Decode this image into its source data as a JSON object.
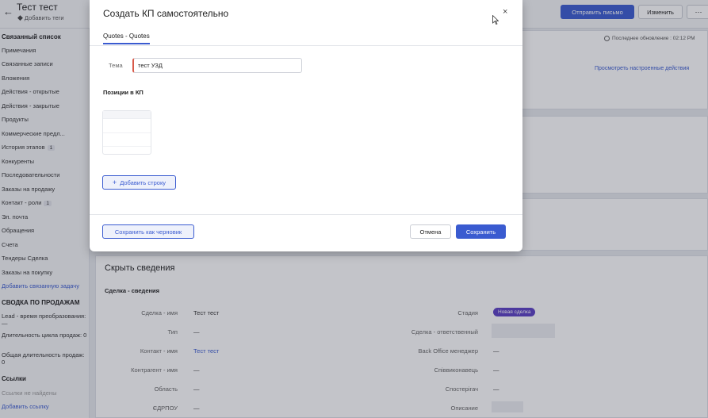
{
  "header": {
    "record_title": "Тест тест",
    "add_tags": "Добавить теги",
    "send_email": "Отправить письмо",
    "edit": "Изменить",
    "more": "⋯",
    "last_update": "Последнее обновление : 02:12 PM",
    "view_actions": "Просмотреть настроенные действия"
  },
  "sidebar": {
    "related_list_title": "Связанный список",
    "items": [
      {
        "label": "Примечания"
      },
      {
        "label": "Связанные записи"
      },
      {
        "label": "Вложения"
      },
      {
        "label": "Действия - открытые"
      },
      {
        "label": "Действия - закрытые"
      },
      {
        "label": "Продукты"
      },
      {
        "label": "Коммерческие предл..."
      },
      {
        "label": "История этапов",
        "count": "1"
      },
      {
        "label": "Конкуренты"
      },
      {
        "label": "Последовательности"
      },
      {
        "label": "Заказы на продажу"
      },
      {
        "label": "Контакт - роли",
        "count": "1"
      },
      {
        "label": "Эл. почта"
      },
      {
        "label": "Обращения"
      },
      {
        "label": "Счета"
      },
      {
        "label": "Тендеры Сделка"
      },
      {
        "label": "Заказы на покупку"
      }
    ],
    "add_related": "Добавить связанную задачу",
    "sales_summary_title": "СВОДКА ПО ПРОДАЖАМ",
    "summary": [
      {
        "label": "Lead - время преобразования: —"
      },
      {
        "label": "Длительность цикла продаж: 0"
      },
      {
        "label": "Общая длительность продаж: 0"
      }
    ],
    "links_title": "Ссылки",
    "links_empty": "Ссылки не найдены",
    "add_link": "Добавить ссылку"
  },
  "details": {
    "hide_title": "Скрыть сведения",
    "sub_title": "Сделка - сведения",
    "left_fields": [
      {
        "label": "Сделка - имя",
        "value": "Тест тест"
      },
      {
        "label": "Тип",
        "value": "—"
      },
      {
        "label": "Контакт - имя",
        "value": "Тест тест"
      },
      {
        "label": "Контрагент - имя",
        "value": "—"
      },
      {
        "label": "Область",
        "value": "—"
      },
      {
        "label": "ЄДРПОУ",
        "value": "—"
      }
    ],
    "right_fields": [
      {
        "label": "Стадия",
        "value": "Новая сделка"
      },
      {
        "label": "Сделка - ответственный",
        "value": ""
      },
      {
        "label": "Back Office менеджер",
        "value": "—"
      },
      {
        "label": "Співвиконавець",
        "value": "—"
      },
      {
        "label": "Спостерігач",
        "value": "—"
      },
      {
        "label": "Описание",
        "value": ""
      }
    ],
    "stage_color": "#5b3fc4"
  },
  "modal": {
    "title": "Создать КП самостоятельно",
    "close": "×",
    "tab": "Quotes - Quotes",
    "subject_label": "Тема",
    "subject_value": "тест УЗД",
    "positions_title": "Позиции в КП",
    "add_row": "Добавить строку",
    "save_draft": "Сохранить как черновик",
    "cancel": "Отмена",
    "save": "Сохранить"
  },
  "colors": {
    "accent": "#3a5bd0",
    "required_marker": "#d85a4a"
  },
  "icons": [
    "back-arrow-icon",
    "tag-icon",
    "clock-icon",
    "close-icon",
    "plus-icon",
    "mouse-cursor-icon"
  ]
}
